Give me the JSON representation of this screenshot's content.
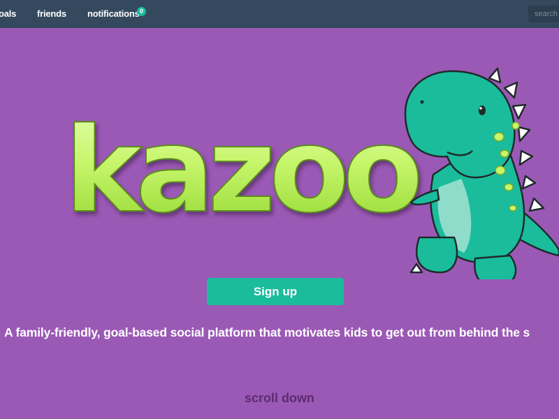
{
  "nav": {
    "goals_label": "oals",
    "friends_label": "friends",
    "notifications_label": "notifications",
    "notifications_count": "0",
    "search_placeholder": "search"
  },
  "hero": {
    "logo_text": "kazoo",
    "logo_icon": "dinosaur-mascot",
    "signup_label": "Sign up",
    "tagline": "A family-friendly, goal-based social platform that motivates kids to get out from behind the s",
    "scroll_label": "scroll down"
  },
  "colors": {
    "background": "#9b59b6",
    "navbar": "#34495e",
    "accent": "#1abc9c",
    "logo_green": "#b8f05a",
    "scroll_text": "#5b2c6f"
  }
}
